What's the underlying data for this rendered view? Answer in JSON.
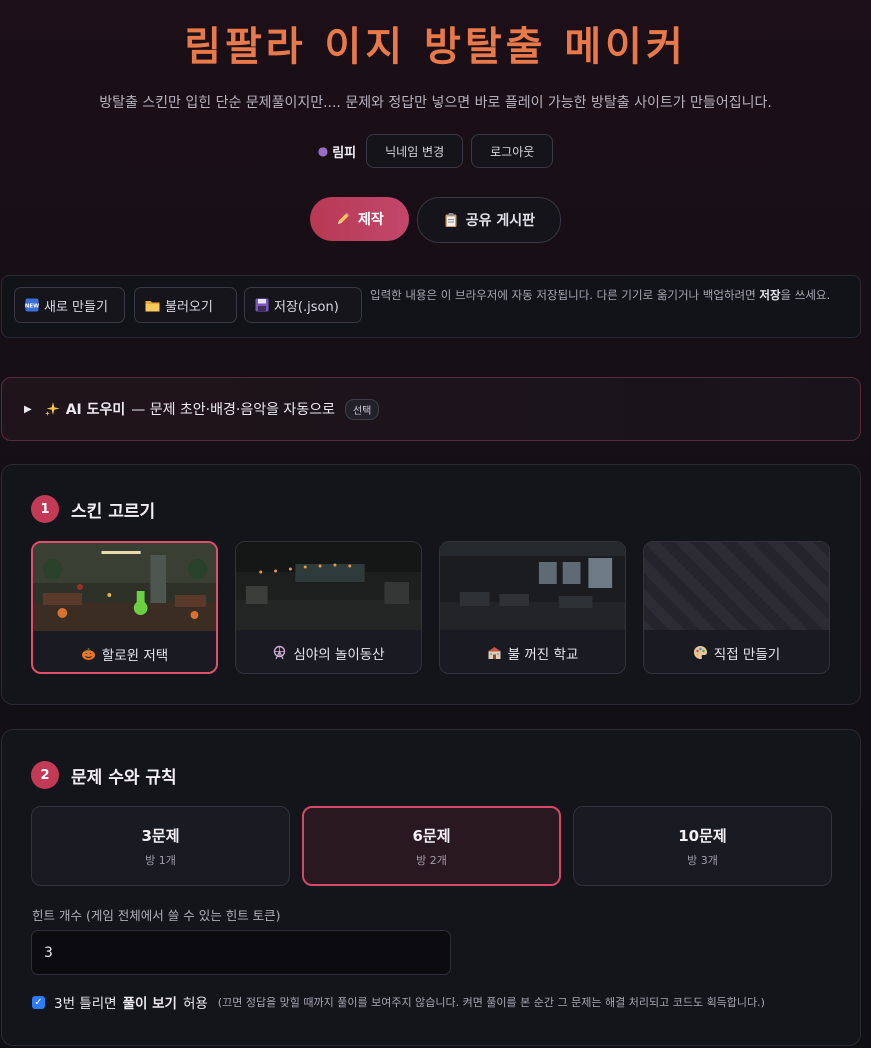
{
  "header": {
    "title": "림팔라 이지 방탈출 메이커",
    "subtitle": "방탈출 스킨만 입힌 단순 문제풀이지만.... 문제와 정답만 넣으면 바로 플레이 가능한 방탈출 사이트가 만들어집니다."
  },
  "user": {
    "icon": "user-icon",
    "name": "림피",
    "change_nickname": "닉네임 변경",
    "logout": "로그아웃"
  },
  "modes": [
    {
      "label": "제작",
      "icon": "pencil-icon",
      "active": true
    },
    {
      "label": "공유 게시판",
      "icon": "clipboard-icon",
      "active": false
    }
  ],
  "filebar": {
    "new_label": "새로 만들기",
    "new_icon": "new-badge-icon",
    "load_label": "불러오기",
    "load_icon": "folder-icon",
    "save_label": "저장(.json)",
    "save_icon": "floppy-icon",
    "note_prefix": "입력한 내용은 이 브라우저에 자동 저장됩니다. 다른 기기로 옮기거나 백업하려면 ",
    "note_bold": "저장",
    "note_suffix": "을 쓰세요."
  },
  "ai": {
    "icon": "sparkles-icon",
    "title": "AI 도우미",
    "desc": "— 문제 초안·배경·음악을 자동으로",
    "badge": "선택"
  },
  "section1": {
    "number": "1",
    "title": "스킨 고르기",
    "skins": [
      {
        "label": "할로윈 저택",
        "icon": "pumpkin-icon",
        "selected": true
      },
      {
        "label": "심야의 놀이동산",
        "icon": "ferris-wheel-icon",
        "selected": false
      },
      {
        "label": "불 꺼진 학교",
        "icon": "school-icon",
        "selected": false
      },
      {
        "label": "직접 만들기",
        "icon": "palette-icon",
        "selected": false
      }
    ]
  },
  "section2": {
    "number": "2",
    "title": "문제 수와 규칙",
    "options": [
      {
        "count": "3문제",
        "rooms": "방 1개",
        "selected": false
      },
      {
        "count": "6문제",
        "rooms": "방 2개",
        "selected": true
      },
      {
        "count": "10문제",
        "rooms": "방 3개",
        "selected": false
      }
    ],
    "hint_label": "힌트 개수 (게임 전체에서 쓸 수 있는 힌트 토큰)",
    "hint_value": "3",
    "solution_prefix": "3번 틀리면",
    "solution_bold": "풀이 보기",
    "solution_suffix": "허용",
    "solution_note": "(끄면 정답을 맞힐 때까지 풀이를 보여주지 않습니다. 켜면 풀이를 본 순간 그 문제는 해결 처리되고 코드도 획득합니다.)",
    "solution_checked": true
  }
}
